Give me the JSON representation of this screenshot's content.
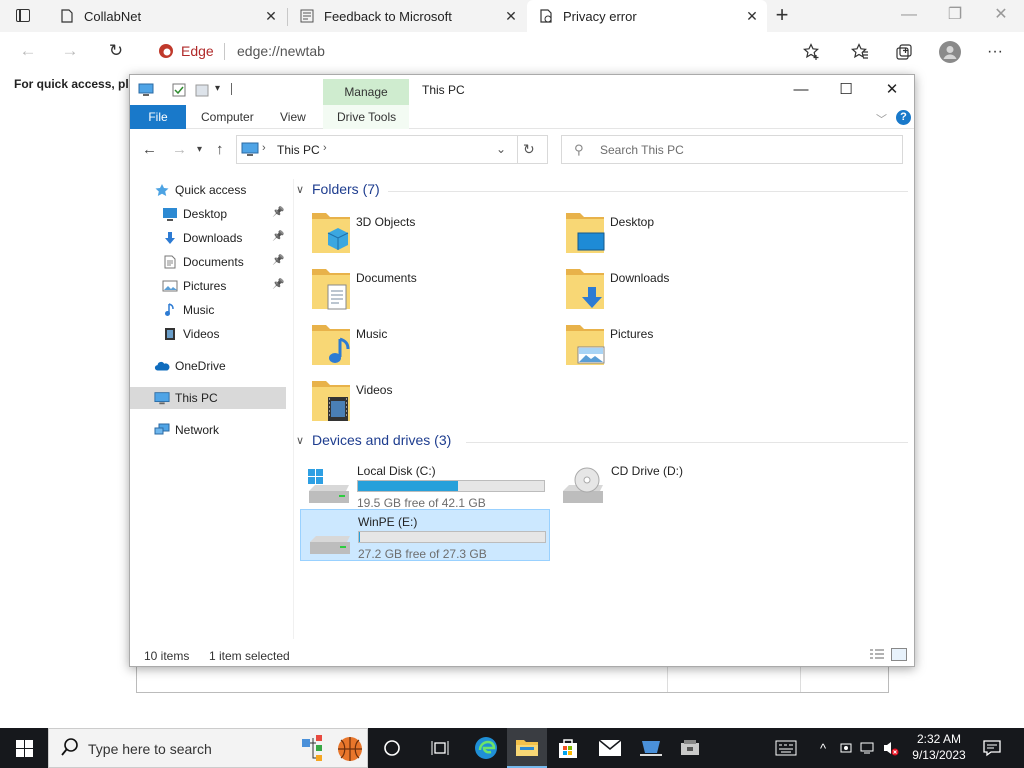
{
  "browser": {
    "tabs": [
      {
        "label": "CollabNet",
        "close": "✕"
      },
      {
        "label": "Feedback to Microsoft",
        "close": "✕"
      },
      {
        "label": "Privacy error",
        "close": "✕"
      }
    ],
    "address_label": "Edge",
    "address_url": "edge://newtab",
    "favorites_hint": "For quick access, plac"
  },
  "explorer": {
    "manage_tab": "Manage",
    "title": "This PC",
    "ribbon_tabs": [
      "File",
      "Computer",
      "View",
      "Drive Tools"
    ],
    "breadcrumb": "This PC",
    "search_placeholder": "Search This PC",
    "nav": [
      {
        "label": "Quick access",
        "icon": "star-icon"
      },
      {
        "label": "Desktop",
        "icon": "desktop-icon",
        "pinned": true
      },
      {
        "label": "Downloads",
        "icon": "downloads-icon",
        "pinned": true
      },
      {
        "label": "Documents",
        "icon": "documents-icon",
        "pinned": true
      },
      {
        "label": "Pictures",
        "icon": "pictures-icon",
        "pinned": true
      },
      {
        "label": "Music",
        "icon": "music-icon"
      },
      {
        "label": "Videos",
        "icon": "videos-icon"
      },
      {
        "label": "OneDrive",
        "icon": "onedrive-icon"
      },
      {
        "label": "This PC",
        "icon": "this-pc-icon",
        "selected": true
      },
      {
        "label": "Network",
        "icon": "network-icon"
      }
    ],
    "folders_header": "Folders (7)",
    "folders": [
      {
        "label": "3D Objects",
        "icon": "3d-objects-folder-icon"
      },
      {
        "label": "Desktop",
        "icon": "desktop-folder-icon"
      },
      {
        "label": "Documents",
        "icon": "documents-folder-icon"
      },
      {
        "label": "Downloads",
        "icon": "downloads-folder-icon"
      },
      {
        "label": "Music",
        "icon": "music-folder-icon"
      },
      {
        "label": "Pictures",
        "icon": "pictures-folder-icon"
      },
      {
        "label": "Videos",
        "icon": "videos-folder-icon"
      }
    ],
    "devices_header": "Devices and drives (3)",
    "drives": [
      {
        "label": "Local Disk (C:)",
        "free": "19.5 GB free of 42.1 GB",
        "used_fraction": 0.537,
        "icon": "windows-drive-icon"
      },
      {
        "label": "CD Drive (D:)",
        "icon": "cd-drive-icon"
      },
      {
        "label": "WinPE (E:)",
        "free": "27.2 GB free of 27.3 GB",
        "used_fraction": 0.004,
        "icon": "hard-drive-icon",
        "selected": true
      }
    ],
    "status_items": "10 items",
    "status_selected": "1 item selected"
  },
  "taskbar": {
    "search_placeholder": "Type here to search",
    "time": "2:32 AM",
    "date": "9/13/2023"
  },
  "colors": {
    "accent": "#1979ca",
    "manage_tab": "#cfeccf",
    "selection": "#cce8ff",
    "drive_bar": "#26a0da",
    "taskbar": "#16181c"
  }
}
